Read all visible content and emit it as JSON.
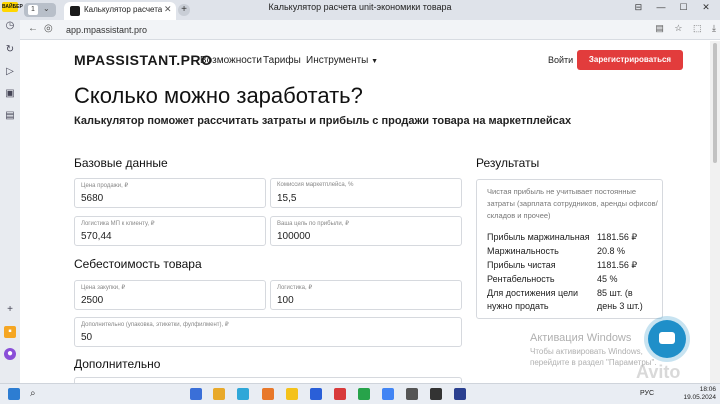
{
  "browser": {
    "workspace_number": "1",
    "tab_title": "Калькулятор расчета u",
    "window_title": "Калькулятор расчета unit-экономики товара",
    "url": "app.mpassistant.pro",
    "sidebar_badge": "ВАЙБЕР"
  },
  "header": {
    "logo": "MPASSISTANT.PRO",
    "nav": [
      "Возможности",
      "Тарифы",
      "Инструменты"
    ],
    "login": "Войти",
    "signup": "Зарегистрироваться"
  },
  "hero": {
    "title": "Сколько можно заработать?",
    "subtitle": "Калькулятор поможет рассчитать затраты и прибыль с продажи товара на маркетплейсах"
  },
  "base": {
    "heading": "Базовые данные",
    "fields": [
      {
        "label": "Цена продажи, ₽",
        "value": "5680"
      },
      {
        "label": "Комиссия маркетплейса, %",
        "value": "15,5"
      },
      {
        "label": "Логистика МП к клиенту, ₽",
        "value": "570,44"
      },
      {
        "label": "Ваша цель по прибыли, ₽",
        "value": "100000"
      }
    ]
  },
  "cost": {
    "heading": "Себестоимость товара",
    "fields": [
      {
        "label": "Цена закупки, ₽",
        "value": "2500"
      },
      {
        "label": "Логистика, ₽",
        "value": "100"
      },
      {
        "label": "Дополнительно (упаковка, этикетки, фулфилмент), ₽",
        "value": "50"
      }
    ]
  },
  "extra": {
    "heading": "Дополнительно"
  },
  "results": {
    "heading": "Результаты",
    "note": "Чистая прибыль не учитывает постоянные затраты (зарплата сотрудников, аренды офисов/складов и прочее)",
    "rows": [
      {
        "label": "Прибыль маржинальная",
        "value": "1181.56 ₽"
      },
      {
        "label": "Маржинальность",
        "value": "20.8 %"
      },
      {
        "label": "Прибыль чистая",
        "value": "1181.56 ₽"
      },
      {
        "label": "Рентабельность",
        "value": "45 %"
      },
      {
        "label": "Для достижения цели",
        "value": "85 шт. (в"
      },
      {
        "label": "нужно продать",
        "value": "день 3 шт.)"
      }
    ]
  },
  "watermark": {
    "title": "Активация Windows",
    "text": "Чтобы активировать Windows, перейдите в раздел \"Параметры\"."
  },
  "taskbar": {
    "lang": "РУС",
    "time": "18:06",
    "date": "19.05.2024"
  },
  "avito_mark": "Avito"
}
